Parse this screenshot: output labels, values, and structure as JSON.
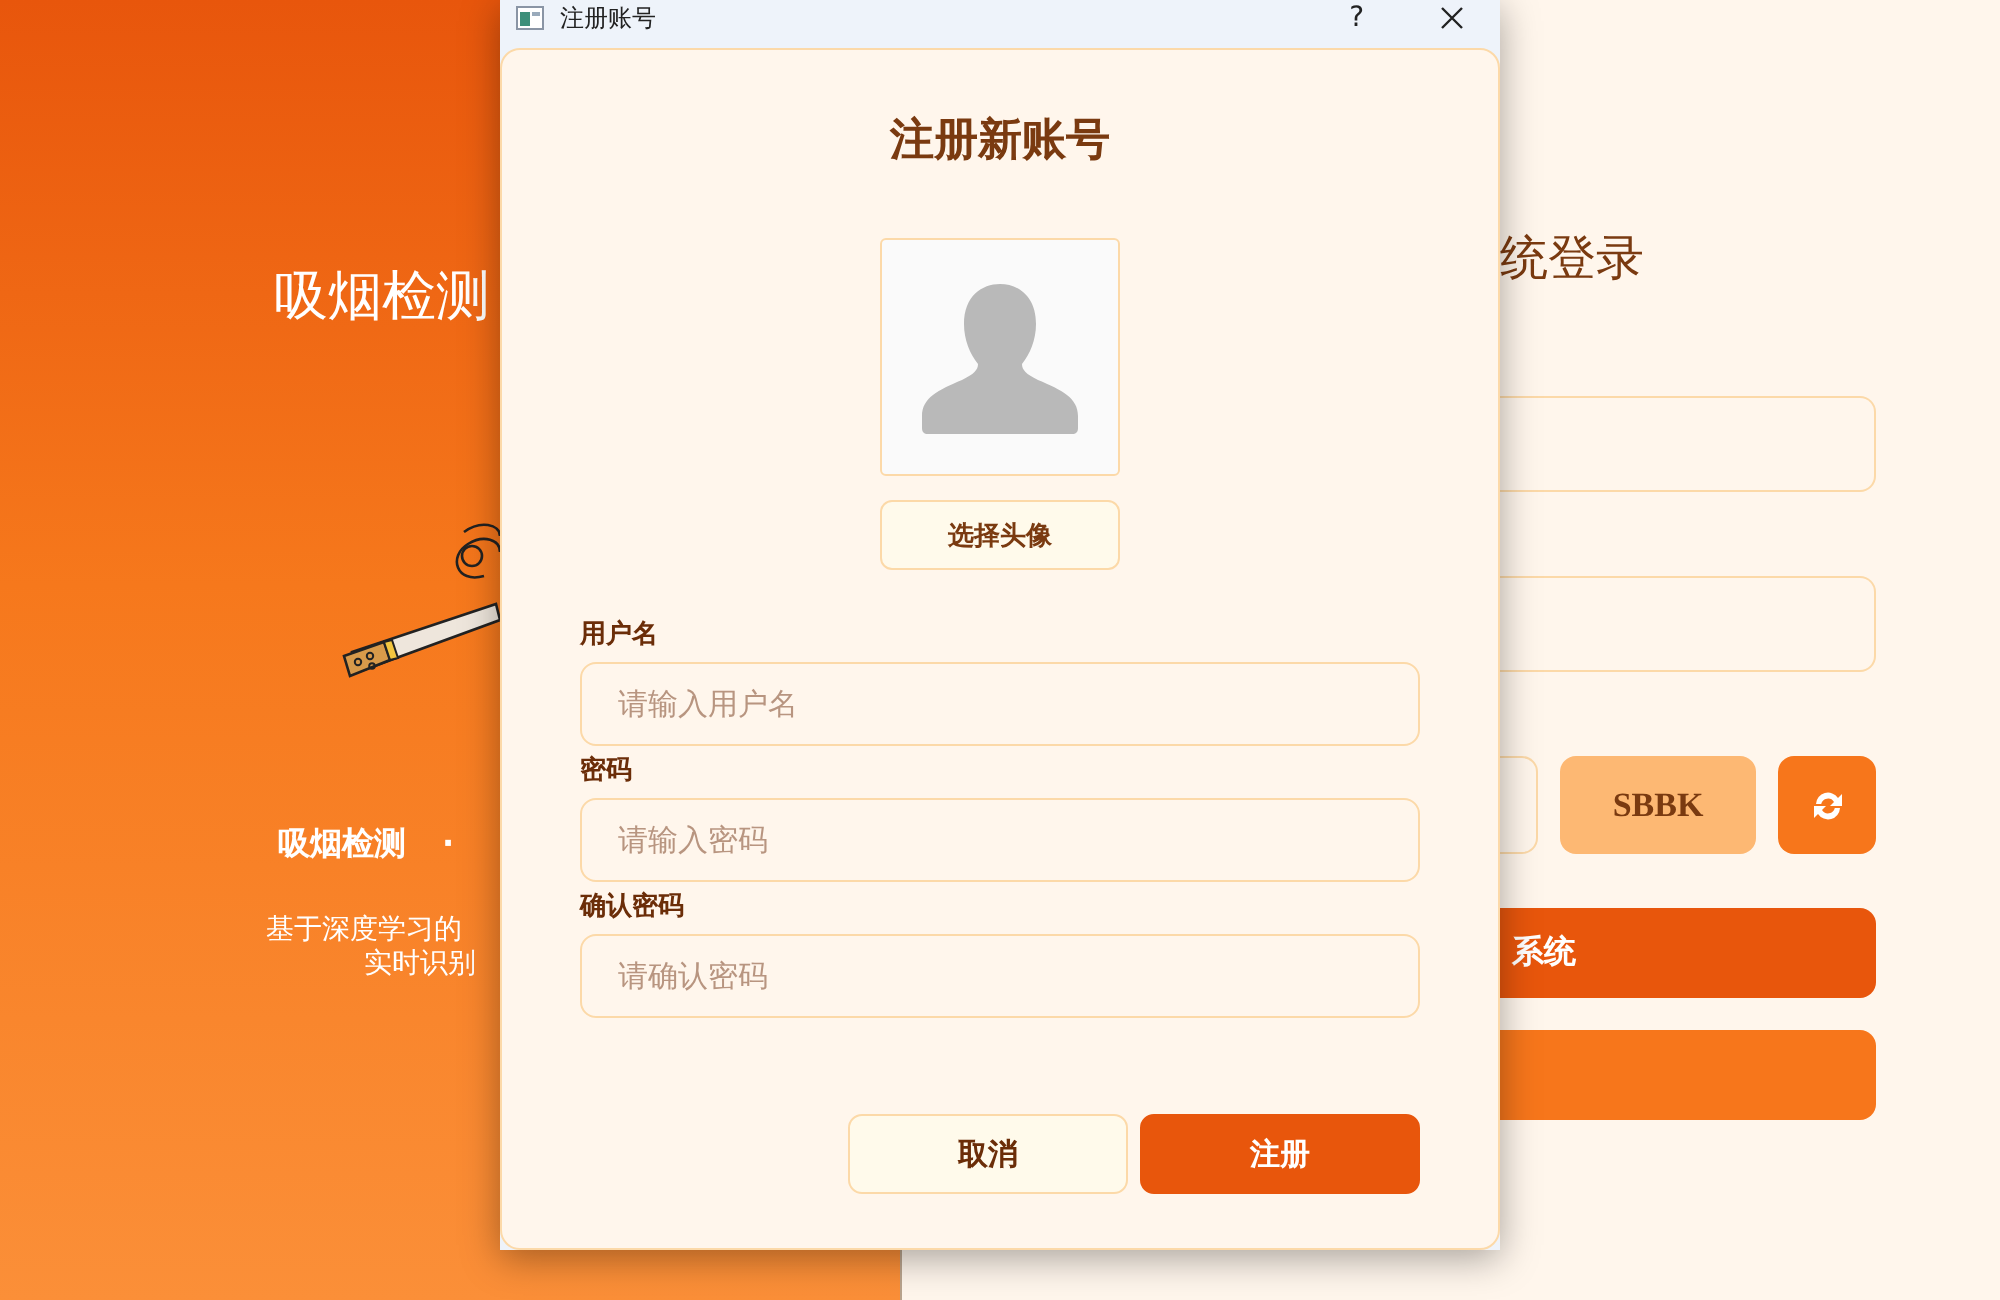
{
  "background_window": {
    "hero": {
      "title": "吸烟检测",
      "tagline": [
        "吸烟检测",
        "·"
      ],
      "description": [
        "基于深度学习的",
        "实时识别"
      ]
    },
    "login": {
      "title": "统登录",
      "captcha": "SBBK",
      "login_button": "系统"
    }
  },
  "dialog": {
    "title": "注册账号",
    "help": "?",
    "heading": "注册新账号",
    "avatar_button": "选择头像",
    "fields": [
      {
        "label": "用户名",
        "placeholder": "请输入用户名"
      },
      {
        "label": "密码",
        "placeholder": "请输入密码"
      },
      {
        "label": "确认密码",
        "placeholder": "请确认密码"
      }
    ],
    "buttons": [
      {
        "kind": "secondary",
        "label": "取消"
      },
      {
        "kind": "primary",
        "label": "注册"
      }
    ]
  }
}
